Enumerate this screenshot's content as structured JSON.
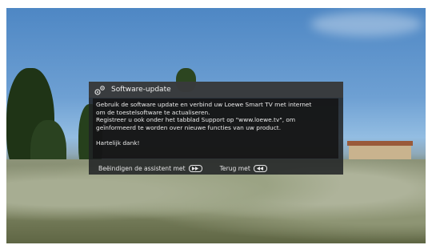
{
  "dialog": {
    "title": "Software-update",
    "body": {
      "line1": "Gebruik de software update en verbind uw Loewe Smart TV met internet",
      "line2": "om de toestelsoftware te actualiseren.",
      "line3": "Registreer u ook onder het tabblad Support op \"www.loewe.tv\", om",
      "line4": "geïnformeerd te worden over nieuwe functies van uw product.",
      "line5": "Hartelijk dank!"
    },
    "footer": {
      "exit_label": "Beëindigen de assistent met",
      "back_label": "Terug met"
    }
  },
  "icons": {
    "header": "gear-icon",
    "exit_key": "fast-forward-key-icon",
    "back_key": "rewind-key-icon"
  },
  "colors": {
    "dialog_bg": "#202224",
    "text": "#ececec"
  }
}
